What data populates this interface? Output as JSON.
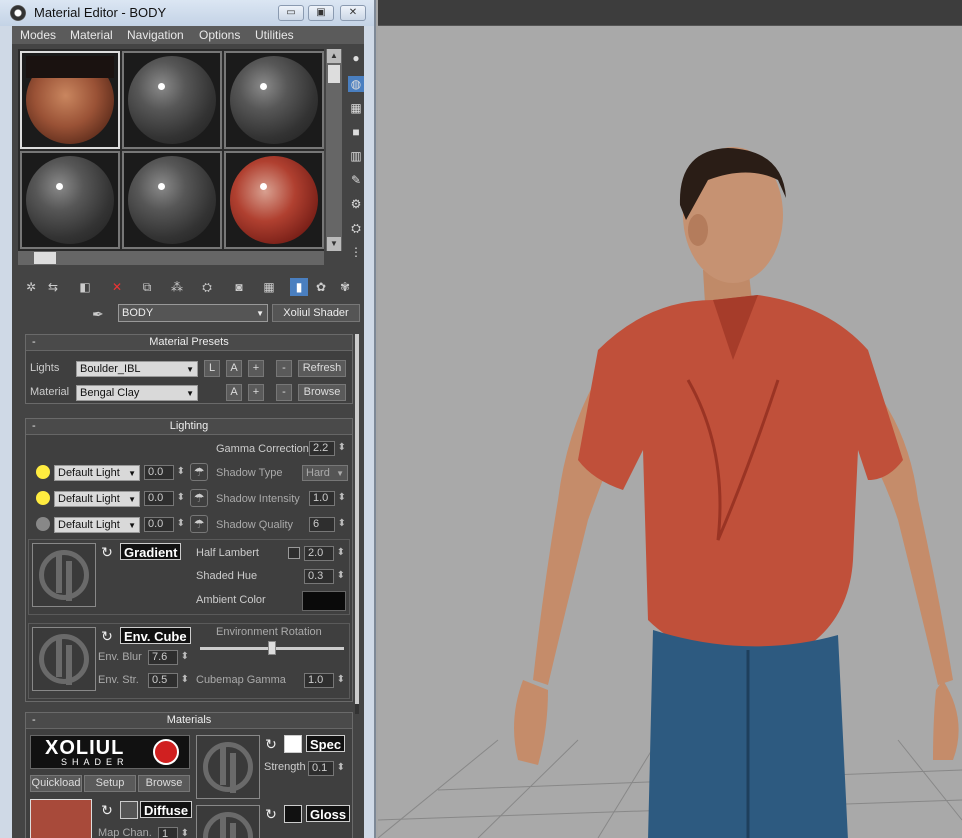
{
  "window": {
    "title": "Material Editor - BODY",
    "minimize": "▭",
    "restore": "▣",
    "close": "✕"
  },
  "menu": [
    "Modes",
    "Material",
    "Navigation",
    "Options",
    "Utilities"
  ],
  "material_name": "BODY",
  "material_type": "Xoliul Shader",
  "presets": {
    "header": "Material Presets",
    "collapse": "-",
    "lights_label": "Lights",
    "lights_value": "Boulder_IBL",
    "material_label": "Material",
    "material_value": "Bengal Clay",
    "btn_l": "L",
    "btn_a": "A",
    "btn_plus": "+",
    "btn_minus": "-",
    "refresh": "Refresh",
    "browse": "Browse"
  },
  "lighting": {
    "header": "Lighting",
    "collapse": "-",
    "gamma_label": "Gamma Correction",
    "gamma_value": "2.2",
    "lights": [
      {
        "name": "Default Light",
        "value": "0.0",
        "on": true
      },
      {
        "name": "Default Light",
        "value": "0.0",
        "on": true
      },
      {
        "name": "Default Light",
        "value": "0.0",
        "on": false
      }
    ],
    "shadow_type_label": "Shadow Type",
    "shadow_type_value": "Hard",
    "shadow_intensity_label": "Shadow Intensity",
    "shadow_intensity_value": "1.0",
    "shadow_quality_label": "Shadow Quality",
    "shadow_quality_value": "6",
    "gradient_label": "Gradient",
    "half_lambert_label": "Half Lambert",
    "half_lambert_value": "2.0",
    "shaded_hue_label": "Shaded Hue",
    "shaded_hue_value": "0.3",
    "ambient_color_label": "Ambient Color",
    "env_cube_label": "Env. Cube",
    "env_rotation_label": "Environment Rotation",
    "env_rotation_fraction": 0.5,
    "env_blur_label": "Env. Blur",
    "env_blur_value": "7.6",
    "env_str_label": "Env. Str.",
    "env_str_value": "0.5",
    "cubemap_gamma_label": "Cubemap Gamma",
    "cubemap_gamma_value": "1.0"
  },
  "materials": {
    "header": "Materials",
    "collapse": "-",
    "logo_top": "XOLIUL",
    "logo_bottom": "SHADER",
    "quickload": "Quickload",
    "setup": "Setup",
    "browse": "Browse",
    "spec_label": "Spec",
    "strength_label": "Strength",
    "strength_value": "0.1",
    "diffuse_label": "Diffuse",
    "map_chan_label": "Map Chan.",
    "map_chan_value": "1",
    "gloss_label": "Gloss"
  },
  "colors": {
    "accent": "#4a7fc0",
    "panel": "#444444",
    "titlebar": "#cfd9e6",
    "viewport_bg": "#a9a9a9",
    "shirt": "#c0503a",
    "jeans": "#2d5a80"
  }
}
